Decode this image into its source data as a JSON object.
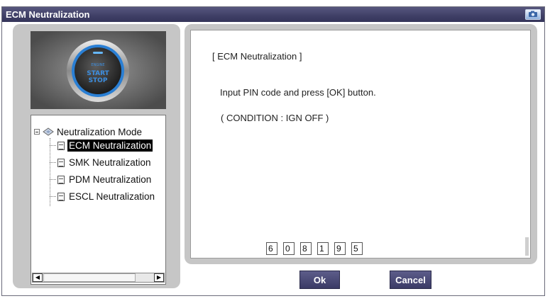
{
  "window": {
    "title": "ECM Neutralization"
  },
  "tree": {
    "root_label": "Neutralization Mode",
    "items": [
      {
        "label": "ECM Neutralization",
        "selected": true
      },
      {
        "label": "SMK Neutralization",
        "selected": false
      },
      {
        "label": "PDM Neutralization",
        "selected": false
      },
      {
        "label": "ESCL Neutralization",
        "selected": false
      }
    ]
  },
  "start_button": {
    "line1": "START",
    "line2": "STOP",
    "small_text": "ENGINE"
  },
  "content": {
    "heading": "[ ECM Neutralization ]",
    "instruction": "Input PIN code and press [OK] button.",
    "condition": "( CONDITION : IGN OFF )",
    "pin": [
      "6",
      "0",
      "8",
      "1",
      "9",
      "5"
    ]
  },
  "buttons": {
    "ok": "Ok",
    "cancel": "Cancel"
  },
  "colors": {
    "title_bar": "#3f3f66",
    "panel": "#c6c6c6",
    "button": "#4a4a76",
    "start_ring": "#2a7fd4"
  }
}
